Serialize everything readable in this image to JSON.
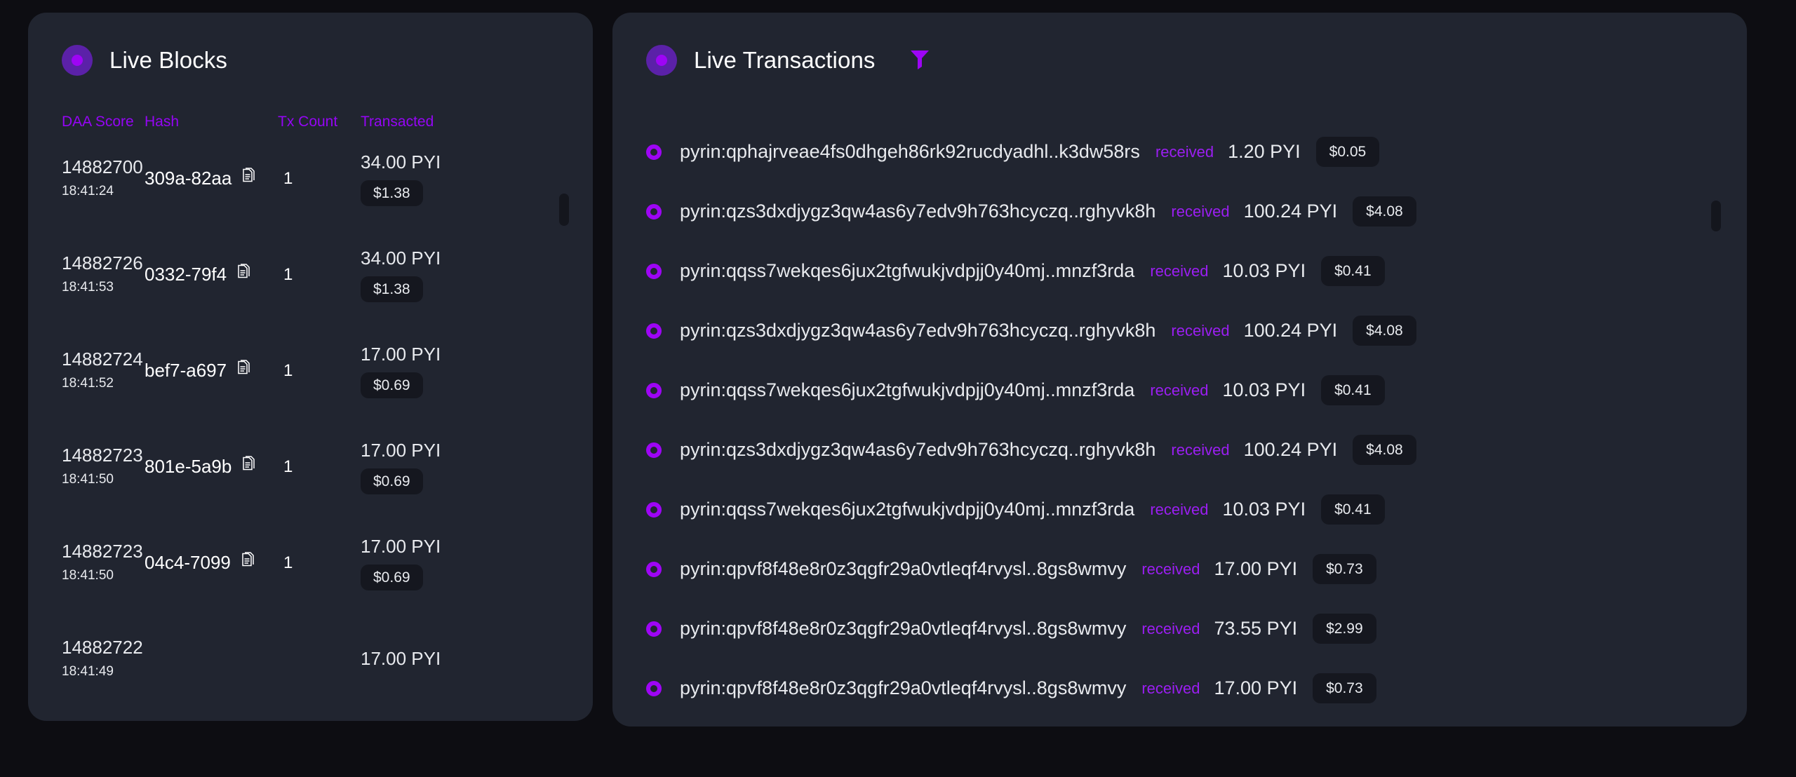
{
  "blocks_panel": {
    "title": "Live Blocks",
    "status_icon": "live-pulse-icon",
    "columns": {
      "daa_score": "DAA Score",
      "hash": "Hash",
      "tx_count": "Tx Count",
      "transacted": "Transacted"
    },
    "rows": [
      {
        "daa_score": "14882700",
        "time": "18:41:24",
        "hash": "309a-82aa",
        "tx_count": "1",
        "amount": "34.00 PYI",
        "usd": "$1.38"
      },
      {
        "daa_score": "14882726",
        "time": "18:41:53",
        "hash": "0332-79f4",
        "tx_count": "1",
        "amount": "34.00 PYI",
        "usd": "$1.38"
      },
      {
        "daa_score": "14882724",
        "time": "18:41:52",
        "hash": "bef7-a697",
        "tx_count": "1",
        "amount": "17.00 PYI",
        "usd": "$0.69"
      },
      {
        "daa_score": "14882723",
        "time": "18:41:50",
        "hash": "801e-5a9b",
        "tx_count": "1",
        "amount": "17.00 PYI",
        "usd": "$0.69"
      },
      {
        "daa_score": "14882723",
        "time": "18:41:50",
        "hash": "04c4-7099",
        "tx_count": "1",
        "amount": "17.00 PYI",
        "usd": "$0.69"
      },
      {
        "daa_score": "14882722",
        "time": "18:41:49",
        "hash": "",
        "tx_count": "",
        "amount": "17.00 PYI",
        "usd": ""
      }
    ]
  },
  "transactions_panel": {
    "title": "Live Transactions",
    "status_icon": "live-pulse-icon",
    "filter_icon": "filter-funnel-icon",
    "rows": [
      {
        "address": "pyrin:qphajrveae4fs0dhgeh86rk92rucdyadhl..k3dw58rs",
        "type": "received",
        "amount": "1.20 PYI",
        "usd": "$0.05"
      },
      {
        "address": "pyrin:qzs3dxdjygz3qw4as6y7edv9h763hcyczq..rghyvk8h",
        "type": "received",
        "amount": "100.24 PYI",
        "usd": "$4.08"
      },
      {
        "address": "pyrin:qqss7wekqes6jux2tgfwukjvdpjj0y40mj..mnzf3rda",
        "type": "received",
        "amount": "10.03 PYI",
        "usd": "$0.41"
      },
      {
        "address": "pyrin:qzs3dxdjygz3qw4as6y7edv9h763hcyczq..rghyvk8h",
        "type": "received",
        "amount": "100.24 PYI",
        "usd": "$4.08"
      },
      {
        "address": "pyrin:qqss7wekqes6jux2tgfwukjvdpjj0y40mj..mnzf3rda",
        "type": "received",
        "amount": "10.03 PYI",
        "usd": "$0.41"
      },
      {
        "address": "pyrin:qzs3dxdjygz3qw4as6y7edv9h763hcyczq..rghyvk8h",
        "type": "received",
        "amount": "100.24 PYI",
        "usd": "$4.08"
      },
      {
        "address": "pyrin:qqss7wekqes6jux2tgfwukjvdpjj0y40mj..mnzf3rda",
        "type": "received",
        "amount": "10.03 PYI",
        "usd": "$0.41"
      },
      {
        "address": "pyrin:qpvf8f48e8r0z3qgfr29a0vtleqf4rvysl..8gs8wmvy",
        "type": "received",
        "amount": "17.00 PYI",
        "usd": "$0.73"
      },
      {
        "address": "pyrin:qpvf8f48e8r0z3qgfr29a0vtleqf4rvysl..8gs8wmvy",
        "type": "received",
        "amount": "73.55 PYI",
        "usd": "$2.99"
      },
      {
        "address": "pyrin:qpvf8f48e8r0z3qgfr29a0vtleqf4rvysl..8gs8wmvy",
        "type": "received",
        "amount": "17.00 PYI",
        "usd": "$0.73"
      }
    ]
  },
  "theme": {
    "page_background": "#0d0d12",
    "panel_background": "#212530",
    "accent_purple": "#9505f5",
    "accent_purple_soft": "#5b21a8",
    "badge_background": "#15171f",
    "text_primary": "#e8eaee"
  }
}
